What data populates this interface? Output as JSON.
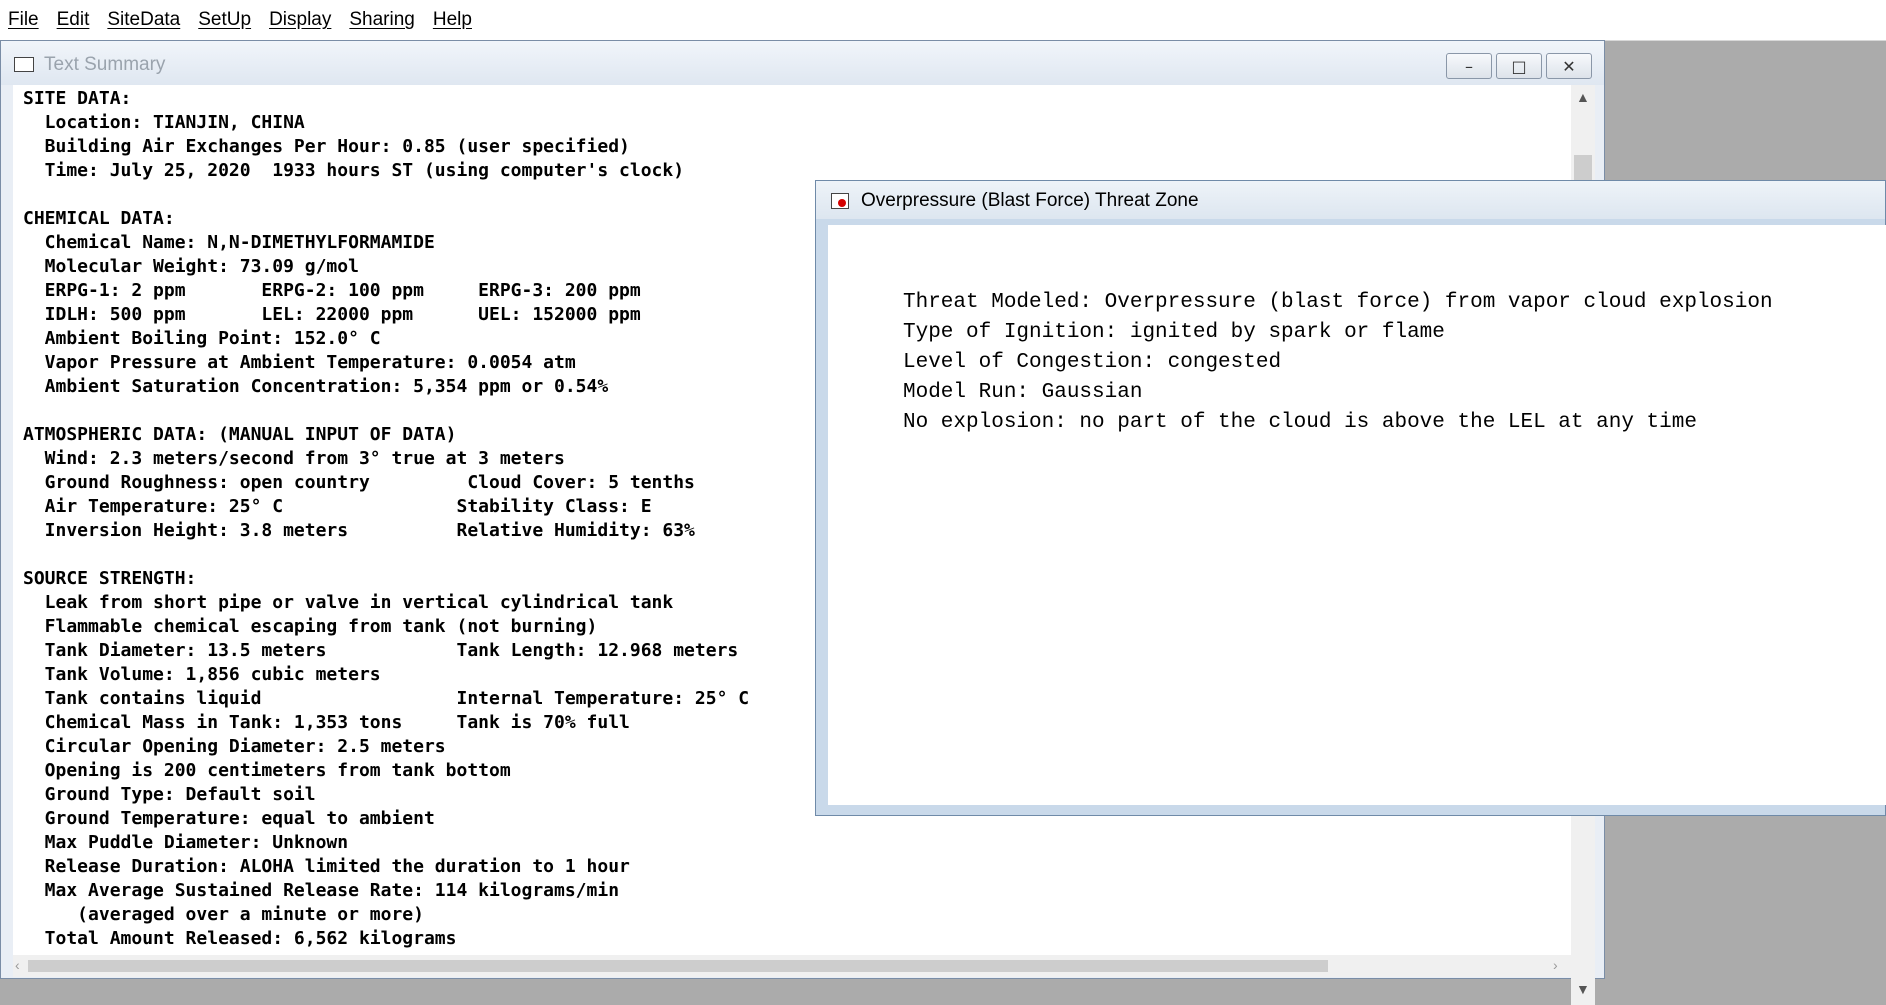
{
  "menu": [
    "File",
    "Edit",
    "SiteData",
    "SetUp",
    "Display",
    "Sharing",
    "Help"
  ],
  "text_summary": {
    "title": "Text Summary",
    "lines": [
      "SITE DATA:",
      "  Location: TIANJIN, CHINA",
      "  Building Air Exchanges Per Hour: 0.85 (user specified)",
      "  Time: July 25, 2020  1933 hours ST (using computer's clock)",
      "",
      "CHEMICAL DATA:",
      "  Chemical Name: N,N-DIMETHYLFORMAMIDE",
      "  Molecular Weight: 73.09 g/mol",
      "  ERPG-1: 2 ppm       ERPG-2: 100 ppm     ERPG-3: 200 ppm",
      "  IDLH: 500 ppm       LEL: 22000 ppm      UEL: 152000 ppm",
      "  Ambient Boiling Point: 152.0° C",
      "  Vapor Pressure at Ambient Temperature: 0.0054 atm",
      "  Ambient Saturation Concentration: 5,354 ppm or 0.54%",
      "",
      "ATMOSPHERIC DATA: (MANUAL INPUT OF DATA)",
      "  Wind: 2.3 meters/second from 3° true at 3 meters",
      "  Ground Roughness: open country         Cloud Cover: 5 tenths",
      "  Air Temperature: 25° C                Stability Class: E",
      "  Inversion Height: 3.8 meters          Relative Humidity: 63%",
      "",
      "SOURCE STRENGTH:",
      "  Leak from short pipe or valve in vertical cylindrical tank",
      "  Flammable chemical escaping from tank (not burning)",
      "  Tank Diameter: 13.5 meters            Tank Length: 12.968 meters",
      "  Tank Volume: 1,856 cubic meters",
      "  Tank contains liquid                  Internal Temperature: 25° C",
      "  Chemical Mass in Tank: 1,353 tons     Tank is 70% full",
      "  Circular Opening Diameter: 2.5 meters",
      "  Opening is 200 centimeters from tank bottom",
      "  Ground Type: Default soil",
      "  Ground Temperature: equal to ambient",
      "  Max Puddle Diameter: Unknown",
      "  Release Duration: ALOHA limited the duration to 1 hour",
      "  Max Average Sustained Release Rate: 114 kilograms/min",
      "     (averaged over a minute or more)",
      "  Total Amount Released: 6,562 kilograms"
    ]
  },
  "threat_zone": {
    "title": "Overpressure (Blast Force) Threat Zone",
    "lines": [
      "Threat Modeled: Overpressure (blast force) from vapor cloud explosion",
      "Type of Ignition: ignited by spark or flame",
      "Level of Congestion: congested",
      "Model Run: Gaussian",
      "No explosion: no part of the cloud is above the LEL at any time"
    ]
  },
  "window_controls": {
    "minimize": "–",
    "maximize": "□",
    "close": "✕"
  },
  "colors": {
    "desktop": "#ababab",
    "window_frame": "#c9d9ea",
    "close_dot": "#d40000"
  }
}
